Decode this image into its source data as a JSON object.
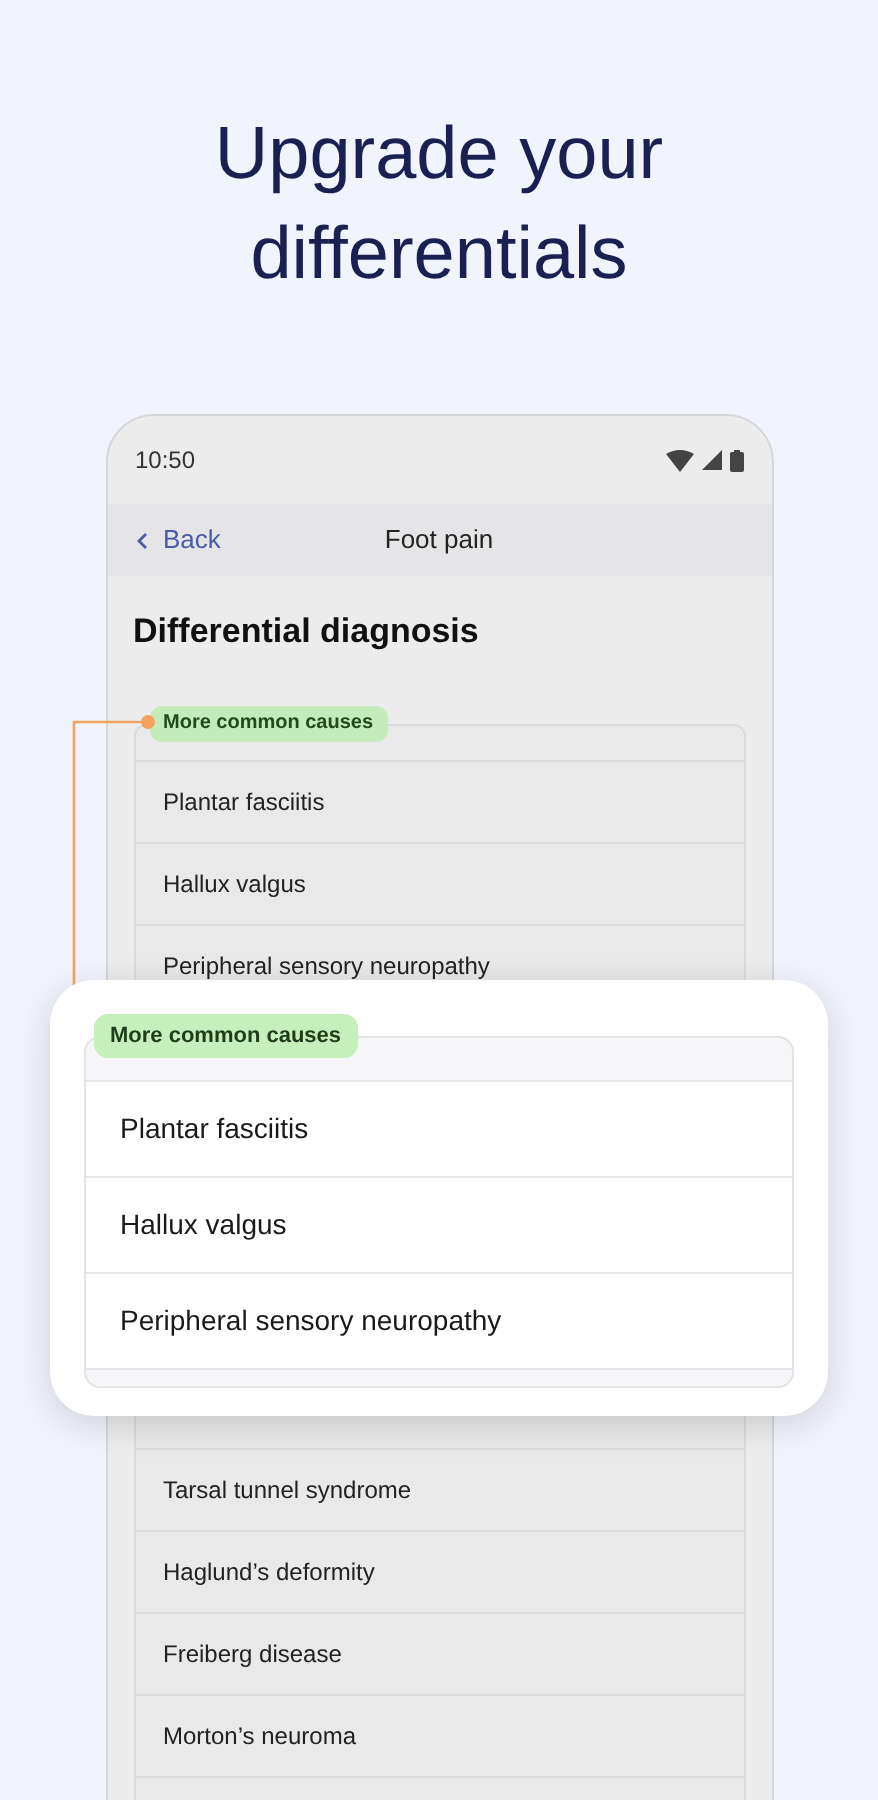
{
  "headline": "Upgrade your differentials",
  "phone": {
    "status_time": "10:50",
    "nav": {
      "back": "Back",
      "title": "Foot pain"
    },
    "heading": "Differential diagnosis",
    "section": {
      "badge": "More common causes",
      "items_top": [
        "Plantar fasciitis",
        "Hallux valgus",
        "Peripheral sensory neuropathy"
      ],
      "items_bottom": [
        "Tarsal tunnel syndrome",
        "Haglund’s deformity",
        "Freiberg disease",
        "Morton’s neuroma"
      ]
    }
  },
  "callout": {
    "badge": "More common causes",
    "items": [
      "Plantar fasciitis",
      "Hallux valgus",
      "Peripheral sensory neuropathy"
    ]
  }
}
